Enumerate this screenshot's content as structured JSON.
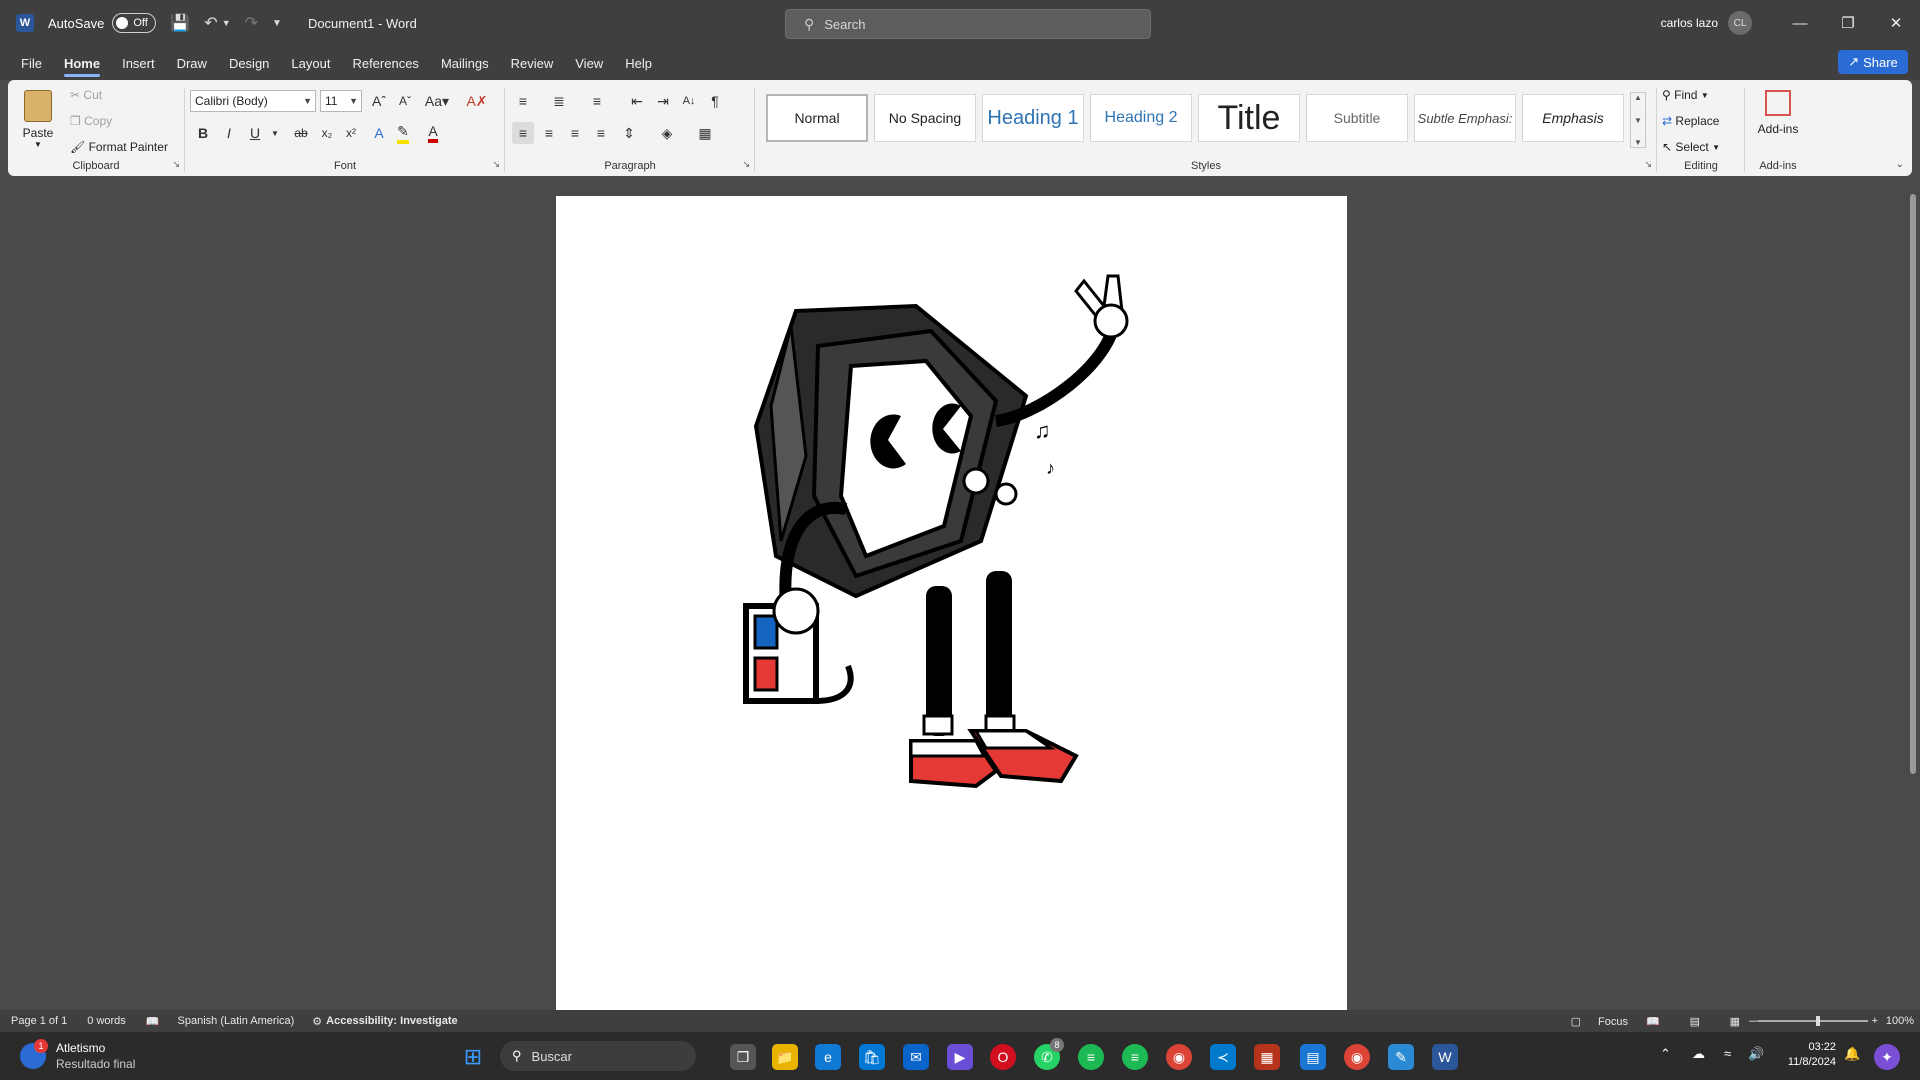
{
  "titlebar": {
    "autosave_label": "AutoSave",
    "autosave_state": "Off",
    "doc_title": "Document1  -  Word",
    "search_placeholder": "Search",
    "user_name": "carlos lazo",
    "user_initials": "CL"
  },
  "tabs": [
    "File",
    "Home",
    "Insert",
    "Draw",
    "Design",
    "Layout",
    "References",
    "Mailings",
    "Review",
    "View",
    "Help"
  ],
  "active_tab": "Home",
  "share_label": "Share",
  "ribbon": {
    "clipboard": {
      "paste": "Paste",
      "cut": "Cut",
      "copy": "Copy",
      "format_painter": "Format Painter",
      "label": "Clipboard"
    },
    "font": {
      "name": "Calibri (Body)",
      "size": "11",
      "label": "Font"
    },
    "paragraph": {
      "label": "Paragraph"
    },
    "styles": {
      "items": [
        "Normal",
        "No Spacing",
        "Heading 1",
        "Heading 2",
        "Title",
        "Subtitle",
        "Subtle Emphasi:",
        "Emphasis"
      ],
      "label": "Styles"
    },
    "editing": {
      "find": "Find",
      "replace": "Replace",
      "select": "Select",
      "label": "Editing"
    },
    "addins": {
      "button": "Add-ins",
      "label": "Add-ins"
    }
  },
  "statusbar": {
    "page": "Page 1 of 1",
    "words": "0 words",
    "language": "Spanish (Latin America)",
    "accessibility": "Accessibility: Investigate",
    "focus": "Focus",
    "zoom": "100%"
  },
  "taskbar": {
    "notif_title": "Atletismo",
    "notif_sub": "Resultado final",
    "notif_badge": "1",
    "search_label": "Buscar",
    "whatsapp_badge": "8",
    "time": "03:22",
    "date": "11/8/2024"
  }
}
